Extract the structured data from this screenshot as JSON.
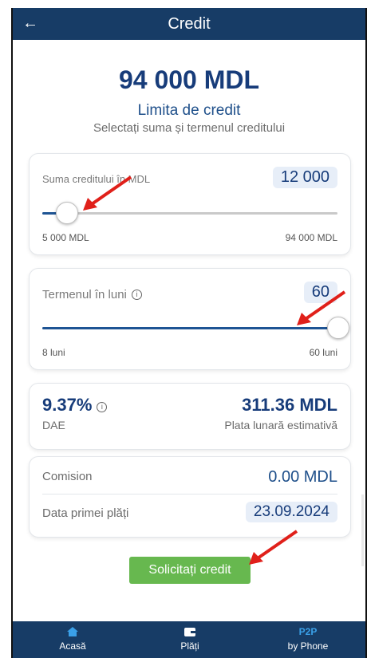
{
  "header": {
    "back_icon": "arrow-left-icon",
    "title": "Credit"
  },
  "summary": {
    "amount": "94 000 MDL",
    "limit_label": "Limita de credit",
    "instruction": "Selectați suma și termenul creditului"
  },
  "sum_slider": {
    "label": "Suma creditului în MDL",
    "value": "12 000",
    "min_label": "5 000 MDL",
    "max_label": "94 000 MDL",
    "fraction": 0.08
  },
  "term_slider": {
    "label": "Termenul în luni",
    "info_icon": "info-icon",
    "value": "60",
    "min_label": "8 luni",
    "max_label": "60 luni",
    "fraction": 1.0
  },
  "rates": {
    "dae_value": "9.37%",
    "dae_label": "DAE",
    "monthly_value": "311.36 MDL",
    "monthly_label": "Plata lunară estimativă"
  },
  "details": {
    "commission_label": "Comision",
    "commission_value": "0.00 MDL",
    "first_payment_label": "Data primei plăți",
    "first_payment_value": "23.09.2024"
  },
  "apply_button": "Solicitați credit",
  "bottom_nav": {
    "home": {
      "icon": "home-icon",
      "label": "Acasă"
    },
    "payments": {
      "icon": "wallet-icon",
      "label": "Plăți"
    },
    "p2p": {
      "badge": "P2P",
      "label": "by Phone"
    }
  },
  "colors": {
    "primary": "#173c66",
    "accent": "#1e5494",
    "button": "#67b84f",
    "annotation": "#e0201a"
  }
}
